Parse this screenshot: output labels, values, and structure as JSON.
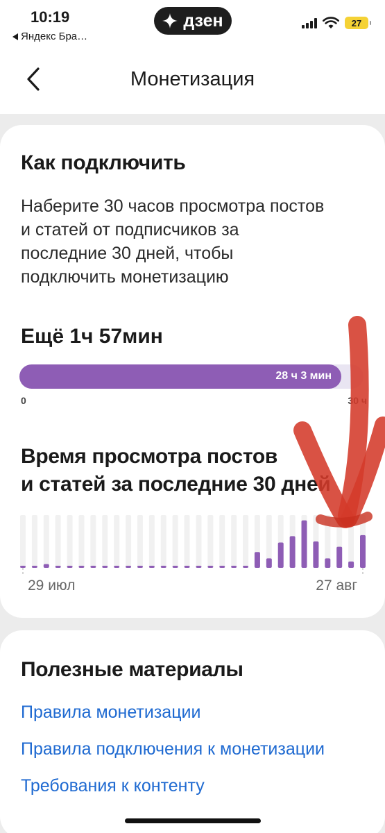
{
  "status": {
    "time": "10:19",
    "back_app": "Яндекс Бра…",
    "app_badge": "дзен",
    "battery": "27"
  },
  "nav": {
    "title": "Монетизация"
  },
  "connect": {
    "title": "Как подключить",
    "description": "Наберите 30 часов просмотра постов и статей от подписчиков за последние 30 дней, чтобы подключить монетизацию",
    "remaining": "Ещё 1ч 57мин",
    "progress_label": "28 ч 3 мин",
    "progress_fraction": 0.935,
    "scale_min": "0",
    "scale_max": "30 ч"
  },
  "chart": {
    "title_line1": "Время просмотра постов",
    "title_line2": "и статей за последние 30 дней",
    "date_start": "29 июл",
    "date_end": "27 авг"
  },
  "chart_data": {
    "type": "bar",
    "values": [
      0.02,
      0.02,
      0.07,
      0.02,
      0.02,
      0.02,
      0.02,
      0.02,
      0.02,
      0.02,
      0.02,
      0.02,
      0.02,
      0.02,
      0.02,
      0.02,
      0.02,
      0.02,
      0.02,
      0.02,
      0.3,
      0.18,
      0.48,
      0.6,
      0.9,
      0.5,
      0.18,
      0.4,
      0.12,
      0.62
    ],
    "colors": {
      "bar": "#8e5db5",
      "track": "#f1f1f1"
    }
  },
  "materials": {
    "title": "Полезные материалы",
    "links": [
      "Правила монетизации",
      "Правила подключения к монетизации",
      "Требования к контенту"
    ]
  }
}
